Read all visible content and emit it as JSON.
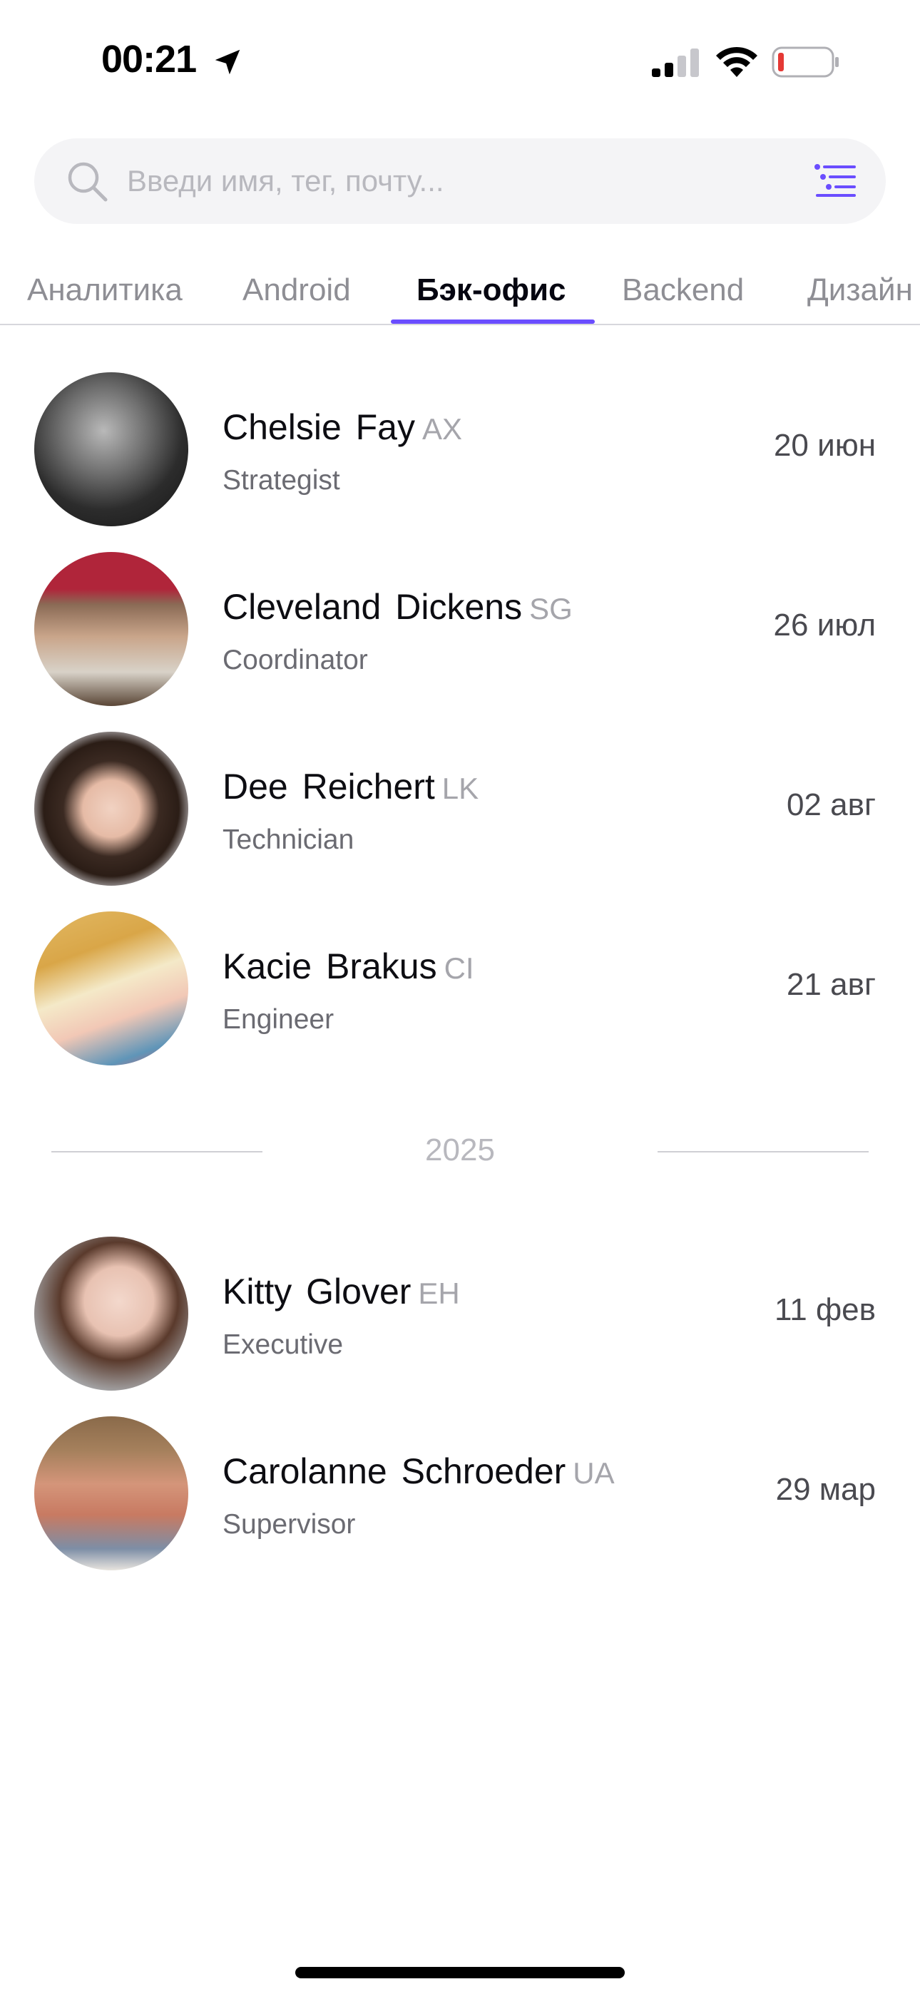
{
  "status_bar": {
    "time": "00:21",
    "icons": [
      "location-arrow-icon",
      "cellular-signal-icon",
      "wifi-icon",
      "battery-low-icon"
    ],
    "battery_color": "#e53935"
  },
  "search": {
    "placeholder": "Введи имя, тег, почту...",
    "value": "",
    "icons": [
      "search-icon",
      "filter-list-icon"
    ],
    "accent_color": "#6a4dff"
  },
  "tabs": {
    "items": [
      {
        "label": "Аналитика",
        "active": false
      },
      {
        "label": "Android",
        "active": false
      },
      {
        "label": "Бэк-офис",
        "active": true
      },
      {
        "label": "Backend",
        "active": false
      },
      {
        "label": "Дизайн",
        "active": false
      }
    ],
    "indicator_color": "#6a4dff"
  },
  "employees_current": [
    {
      "name": "Chelsie Fay",
      "code": "AX",
      "role": "Strategist",
      "date": "20 июн"
    },
    {
      "name": "Cleveland Dickens",
      "code": "SG",
      "role": "Coordinator",
      "date": "26 июл"
    },
    {
      "name": "Dee Reichert",
      "code": "LK",
      "role": "Technician",
      "date": "02 авг"
    },
    {
      "name": "Kacie Brakus",
      "code": "CI",
      "role": "Engineer",
      "date": "21 авг"
    }
  ],
  "year_separator": "2025",
  "employees_next": [
    {
      "name": "Kitty Glover",
      "code": "EH",
      "role": "Executive",
      "date": "11 фев"
    },
    {
      "name": "Carolanne Schroeder",
      "code": "UA",
      "role": "Supervisor",
      "date": "29 мар"
    }
  ]
}
